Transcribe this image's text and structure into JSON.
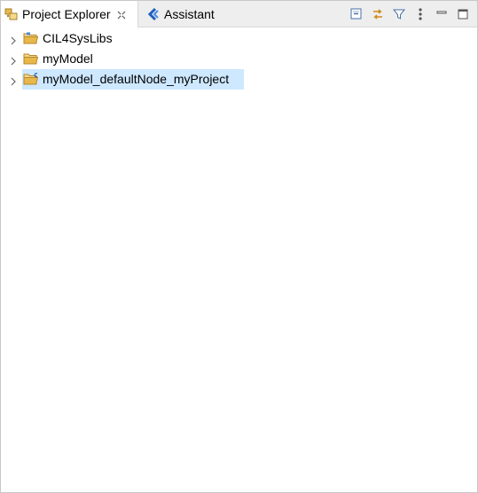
{
  "tabs": {
    "explorer": {
      "label": "Project Explorer",
      "icon": "project-explorer-icon"
    },
    "assistant": {
      "label": "Assistant",
      "icon": "assistant-icon"
    }
  },
  "toolbar": {
    "buttons": [
      "collapse-all-icon",
      "link-with-editor-icon",
      "filter-icon",
      "view-menu-icon",
      "minimize-icon",
      "maximize-icon"
    ]
  },
  "tree": {
    "items": [
      {
        "label": "CIL4SysLibs",
        "icon": "project-folder-icon",
        "selected": false
      },
      {
        "label": "myModel",
        "icon": "folder-icon",
        "selected": false
      },
      {
        "label": "myModel_defaultNode_myProject",
        "icon": "project-folder-c-icon",
        "selected": true
      }
    ]
  },
  "colors": {
    "selection": "#cde8ff",
    "tab_bar": "#eeeeee",
    "accent_blue": "#1f5fbf",
    "folder_yellow": "#e8b84a"
  }
}
